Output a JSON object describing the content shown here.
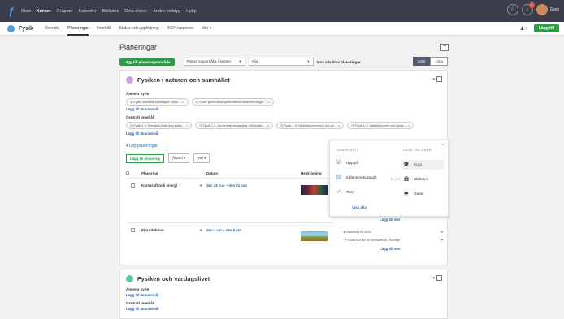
{
  "topnav": {
    "items": [
      {
        "label": "Start",
        "active": false
      },
      {
        "label": "Kurser",
        "active": true
      },
      {
        "label": "Grupper",
        "active": false
      },
      {
        "label": "Kalender",
        "active": false
      },
      {
        "label": "Bibliotek",
        "active": false
      },
      {
        "label": "Dina elever",
        "active": false
      },
      {
        "label": "Andra verktyg",
        "active": false
      },
      {
        "label": "Hjälp",
        "active": false
      }
    ],
    "user_name": "Sven",
    "notification_count": "1"
  },
  "subnav": {
    "course_name": "Fysik",
    "tabs": [
      {
        "label": "Översikt",
        "active": false
      },
      {
        "label": "Planeringar",
        "active": true
      },
      {
        "label": "Innehåll",
        "active": false
      },
      {
        "label": "Status och uppföljning",
        "active": false
      },
      {
        "label": "360°-rapporter",
        "active": false
      },
      {
        "label": "Mer ▾",
        "active": false
      }
    ],
    "add_user_label": "♟+",
    "add_button": "Lägg till"
  },
  "page": {
    "title": "Planeringar",
    "collapse_symbol": "−"
  },
  "toolbar": {
    "add_area_button": "Lägg till planeringsområde",
    "filter_select": "Planer rapport åka Åsaköer",
    "period_select": "Alla",
    "show_all_label": "Visa alla dina planeringar",
    "toggle_selected": "Valet",
    "toggle_other": "Lista"
  },
  "card1": {
    "title": "Fysiken i naturen och samhället",
    "color": "#c9a0dc",
    "aims_label": "Ämnets syfte",
    "aims_chips": [
      "◎ Fysik: använda kunskaper i fysik ... ×",
      "◎ Fysik: genomföra systematiska undersökningar ... ×"
    ],
    "add_reference_1": "Lägg till lärandemål",
    "content_label": "Centralt innehåll",
    "content_chips": [
      "◎ Fysik 1-3: Energins flöde från solen ... ×",
      "◎ Fysik 1-3: Hur energi omvandlas, elektricitet ... ×",
      "◎ Fysik 1-3: Väderfenomen och hur de ... ×",
      "◎ Fysik 1-3: Väderfenomen och deras ... ×"
    ],
    "add_reference_2": "Lägg till lärandemål",
    "group_header": "▾ Dölj planeringar",
    "add_planning_button": "Lägg till planering",
    "action_select": "Åtgärd ▾",
    "view_select": "Vall ▾",
    "columns": [
      "Planering",
      "Datum",
      "Beskrivning"
    ],
    "rows": [
      {
        "name": "Kärnkraft och energi",
        "date": "den 28 mar – den 31 mar"
      },
      {
        "name": "Elproduktion",
        "date": "den 1 apr – den 6 apr"
      }
    ],
    "panel_row1_link": "Lägg till mer",
    "panel_row2_items": [
      "▸ Kandidat till 2050",
      "⦿ Kolla hur din el produceras i Sverige"
    ],
    "panel_row2_link": "Lägg till mer"
  },
  "card2": {
    "title": "Fysiken och vardagslivet",
    "color": "#5fc4b0",
    "aims_label": "Ämnets syfte",
    "add_reference_1": "Lägg till lärandemål",
    "content_label": "Centralt innehåll",
    "add_reference_2": "Lägg till lärandemål"
  },
  "popup": {
    "col_left_header": "SKAPA NYTT",
    "col_right_header": "LÄGG TILL FRÅN",
    "left_items": [
      {
        "icon": "assignment-icon",
        "glyph": "☑",
        "label": "Uppgift",
        "color": "#2e9b45"
      },
      {
        "icon": "discussion-icon",
        "glyph": "▤",
        "label": "Inlämningsuppgift",
        "color": "#4a9de0"
      },
      {
        "icon": "test-icon",
        "glyph": "✓",
        "label": "Test",
        "color": "#d9534f"
      }
    ],
    "right_items": [
      {
        "icon": "course-icon",
        "glyph": "🎓",
        "label": "Kurs",
        "selected": true
      },
      {
        "icon": "library-icon",
        "glyph": "🏛",
        "label": "Bibliotek",
        "selected": false
      },
      {
        "icon": "device-icon",
        "glyph": "💻",
        "label": "Dator",
        "selected": false
      }
    ],
    "or_label": "ELLER",
    "show_all_link": "Visa alla",
    "close_symbol": "×"
  }
}
